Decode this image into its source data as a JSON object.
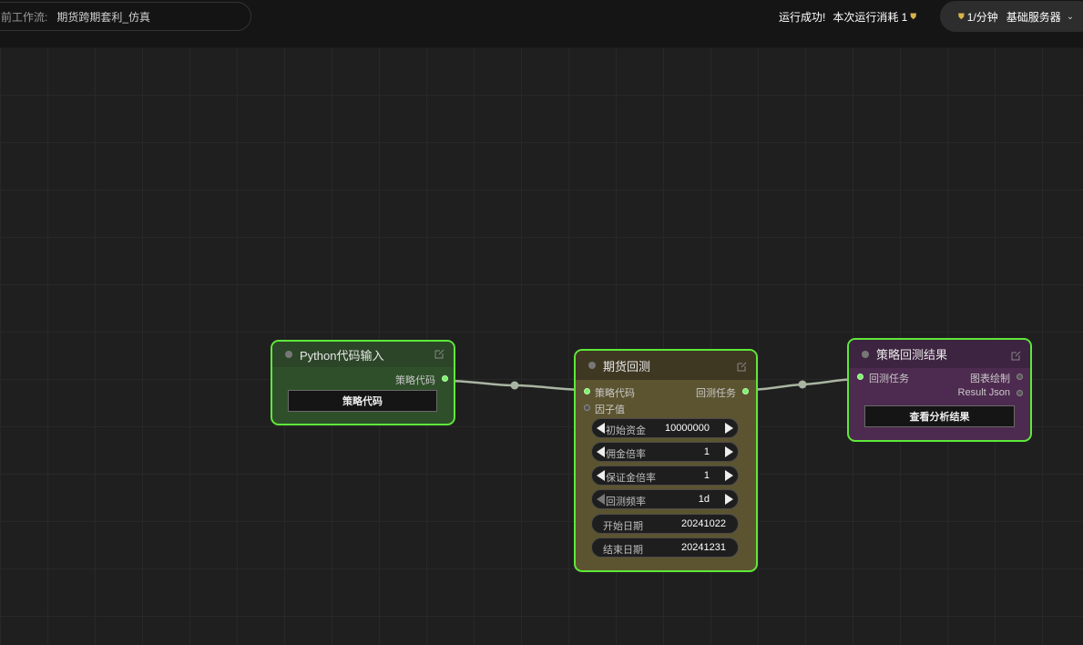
{
  "header": {
    "workflow_label": "前工作流:",
    "workflow_name": "期货跨期套利_仿真",
    "run_status": "运行成功!",
    "cost_label": "本次运行消耗 1",
    "rate": "1/分钟",
    "server": "基础服务器"
  },
  "colors": {
    "selection_border": "#5fe83a",
    "python_node_bg": "#2f4f2a",
    "backtest_node_bg": "#5c5430",
    "result_node_bg": "#4d2a4f",
    "coin": "#d6b44a"
  },
  "nodes": {
    "python": {
      "title": "Python代码输入",
      "output": "策略代码",
      "button": "策略代码"
    },
    "backtest": {
      "title": "期货回测",
      "inputs": [
        "策略代码",
        "因子值"
      ],
      "output": "回测任务",
      "widgets": [
        {
          "label": "初始资金",
          "value": "10000000"
        },
        {
          "label": "佣金倍率",
          "value": "1"
        },
        {
          "label": "保证金倍率",
          "value": "1"
        },
        {
          "label": "回测频率",
          "value": "1d"
        },
        {
          "label": "开始日期",
          "value": "20241022"
        },
        {
          "label": "结束日期",
          "value": "20241231"
        }
      ]
    },
    "result": {
      "title": "策略回测结果",
      "input": "回测任务",
      "outputs": [
        "图表绘制",
        "Result Json"
      ],
      "button": "查看分析结果"
    }
  }
}
